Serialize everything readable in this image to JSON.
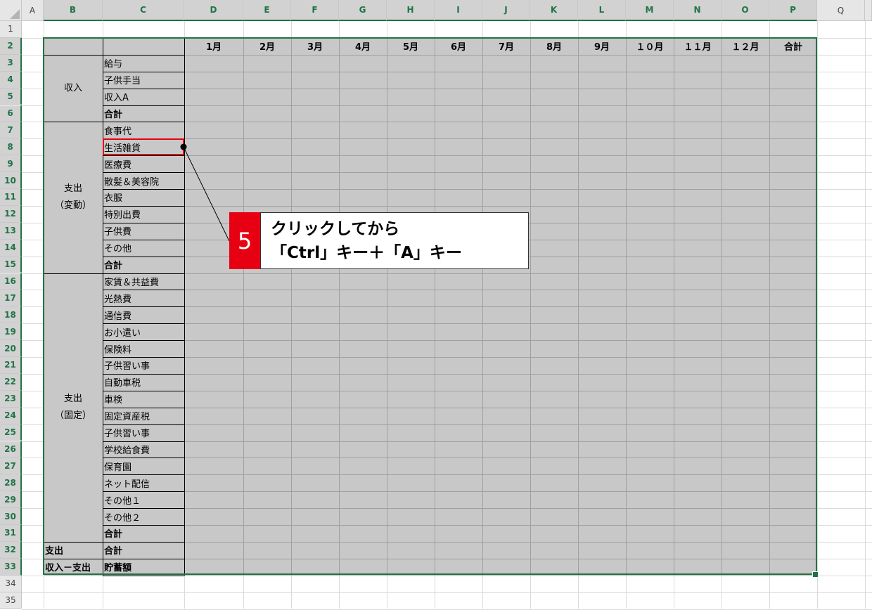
{
  "spreadsheet": {
    "columns": [
      "A",
      "B",
      "C",
      "D",
      "E",
      "F",
      "G",
      "H",
      "I",
      "J",
      "K",
      "L",
      "M",
      "N",
      "O",
      "P",
      "Q"
    ],
    "rows": [
      "1",
      "2",
      "3",
      "4",
      "5",
      "6",
      "7",
      "8",
      "9",
      "10",
      "11",
      "12",
      "13",
      "14",
      "15",
      "16",
      "17",
      "18",
      "19",
      "20",
      "21",
      "22",
      "23",
      "24",
      "25",
      "26",
      "27",
      "28",
      "29",
      "30",
      "31",
      "32",
      "33",
      "34",
      "35"
    ],
    "selected_range": "B2:P33"
  },
  "table": {
    "month_headers": [
      "1月",
      "2月",
      "3月",
      "4月",
      "5月",
      "6月",
      "7月",
      "8月",
      "9月",
      "１０月",
      "１１月",
      "１２月",
      "合計"
    ],
    "groups": [
      "収入",
      "支出\n（変動）",
      "支出\n（固定）"
    ],
    "items": [
      "給与",
      "子供手当",
      "収入A",
      "合計",
      "食事代",
      "生活雑貨",
      "医療費",
      "散髪＆美容院",
      "衣服",
      "特別出費",
      "子供費",
      "その他",
      "合計",
      "家賃＆共益費",
      "光熱費",
      "通信費",
      "お小遣い",
      "保険料",
      "子供習い事",
      "自動車税",
      "車検",
      "固定資産税",
      "子供習い事",
      "学校給食費",
      "保育園",
      "ネット配信",
      "その他１",
      "その他２",
      "合計"
    ],
    "footer_rows": [
      {
        "label": "支出",
        "item": "合計"
      },
      {
        "label": "収入－支出",
        "item": "貯蓄額"
      }
    ],
    "highlighted_item": "生活雑貨"
  },
  "callout": {
    "number": "5",
    "line1": "クリックしてから",
    "line2": "「Ctrl」キー＋「A」キー",
    "number_color": "#e60012"
  },
  "colors": {
    "selection_fill": "#c8c8c8",
    "selection_border": "#217346",
    "highlight_border": "#e60012"
  }
}
